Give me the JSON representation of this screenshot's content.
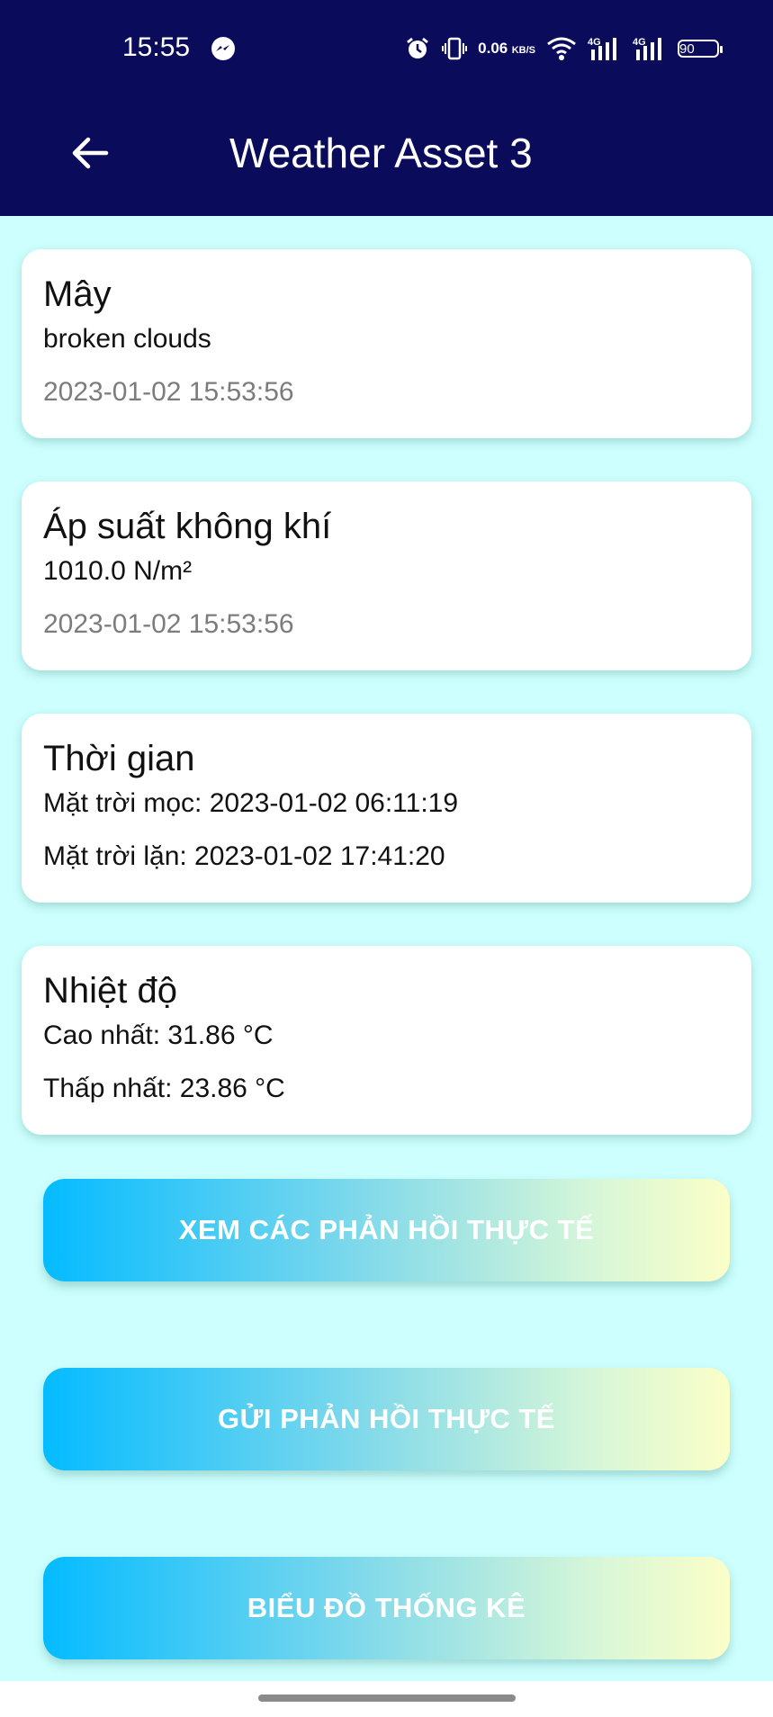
{
  "status_bar": {
    "time": "15:55",
    "net_speed_value": "0.06",
    "net_speed_unit": "KB/S",
    "signal1_label": "4G",
    "signal2_label": "4G",
    "battery": "90",
    "icons": [
      "messenger-icon",
      "alarm-icon",
      "vibrate-icon",
      "wifi-icon",
      "signal-icon",
      "signal-icon",
      "battery-icon"
    ]
  },
  "app_bar": {
    "title": "Weather Asset 3",
    "back_icon": "arrow-left-icon"
  },
  "cards": {
    "clouds": {
      "title": "Mây",
      "description": "broken clouds",
      "timestamp": "2023-01-02 15:53:56"
    },
    "pressure": {
      "title": "Áp suất không khí",
      "value": "1010.0 N/m²",
      "timestamp": "2023-01-02 15:53:56"
    },
    "time": {
      "title": "Thời gian",
      "sunrise": "Mặt trời mọc: 2023-01-02 06:11:19",
      "sunset": "Mặt trời lặn: 2023-01-02 17:41:20"
    },
    "temperature": {
      "title": "Nhiệt độ",
      "max": "Cao nhất: 31.86 °C",
      "min": "Thấp nhất: 23.86 °C"
    }
  },
  "buttons": {
    "view_feedback": "XEM CÁC PHẢN HỒI THỰC TẾ",
    "send_feedback": "GỬI PHẢN HỒI THỰC TẾ",
    "statistics_chart": "BIỂU ĐỒ THỐNG KÊ"
  },
  "colors": {
    "header_bg": "#0b0b5c",
    "page_bg": "#ccfffd",
    "button_gradient_start": "#04bbff",
    "button_gradient_end": "#fbfec8"
  }
}
